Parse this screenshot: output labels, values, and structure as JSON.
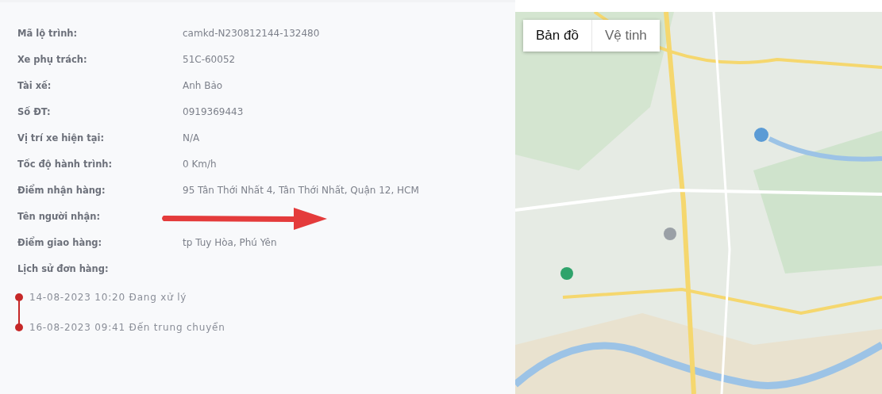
{
  "details": [
    {
      "label": "Mã lộ trình:",
      "value": "camkd-N230812144-132480"
    },
    {
      "label": "Xe phụ trách:",
      "value": "51C-60052"
    },
    {
      "label": "Tài xế:",
      "value": "Anh Bảo"
    },
    {
      "label": "Số ĐT:",
      "value": "0919369443"
    },
    {
      "label": "Vị trí xe hiện tại:",
      "value": "N/A"
    },
    {
      "label": "Tốc độ hành trình:",
      "value": "0 Km/h"
    },
    {
      "label": "Điểm nhận hàng:",
      "value": "95 Tân Thới Nhất 4, Tân Thới Nhất, Quận 12, HCM"
    },
    {
      "label": "Tên người nhận:",
      "annotated": true
    },
    {
      "label": "Điểm giao hàng:",
      "value": "tp Tuy Hòa, Phú Yên"
    },
    {
      "label": "Lịch sử đơn hàng:"
    }
  ],
  "history": [
    {
      "text": "14-08-2023 10:20 Đang xử lý"
    },
    {
      "text": "16-08-2023 09:41 Đến trung chuyển"
    }
  ],
  "map": {
    "kind": "picture",
    "map_types": [
      {
        "label": "Bản đồ",
        "selected": true
      },
      {
        "label": "Vệ tinh",
        "selected": false
      }
    ]
  }
}
